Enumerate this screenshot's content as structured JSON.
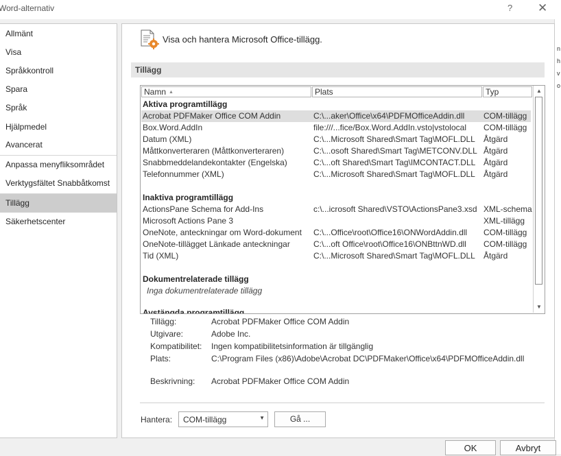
{
  "window": {
    "title": "Word-alternativ",
    "help_glyph": "?",
    "close_glyph": "✕"
  },
  "right_strip": {
    "letters": [
      "n",
      "h",
      "v",
      "o"
    ]
  },
  "nav": {
    "items": [
      {
        "label": "Allmänt"
      },
      {
        "label": "Visa"
      },
      {
        "label": "Språkkontroll"
      },
      {
        "label": "Spara"
      },
      {
        "label": "Språk"
      },
      {
        "label": "Hjälpmedel"
      },
      {
        "label": "Avancerat"
      },
      {
        "label": "Anpassa menyfliksområdet"
      },
      {
        "label": "Verktygsfältet Snabbåtkomst"
      },
      {
        "label": "Tillägg"
      },
      {
        "label": "Säkerhetscenter"
      }
    ]
  },
  "main": {
    "header": "Visa och hantera Microsoft Office-tillägg.",
    "section": "Tillägg",
    "columns": {
      "name": "Namn",
      "location": "Plats",
      "type": "Typ"
    },
    "groups": [
      {
        "title": "Aktiva programtillägg",
        "rows": [
          {
            "name": "Acrobat PDFMaker Office COM Addin",
            "location": "C:\\...aker\\Office\\x64\\PDFMOfficeAddin.dll",
            "type": "COM-tillägg",
            "selected": true
          },
          {
            "name": "Box.Word.AddIn",
            "location": "file:///...fice/Box.Word.AddIn.vsto|vstolocal",
            "type": "COM-tillägg"
          },
          {
            "name": "Datum (XML)",
            "location": "C:\\...Microsoft Shared\\Smart Tag\\MOFL.DLL",
            "type": "Åtgärd"
          },
          {
            "name": "Måttkonverteraren (Måttkonverteraren)",
            "location": "C:\\...osoft Shared\\Smart Tag\\METCONV.DLL",
            "type": "Åtgärd"
          },
          {
            "name": "Snabbmeddelandekontakter (Engelska)",
            "location": "C:\\...oft Shared\\Smart Tag\\IMCONTACT.DLL",
            "type": "Åtgärd"
          },
          {
            "name": "Telefonnummer (XML)",
            "location": "C:\\...Microsoft Shared\\Smart Tag\\MOFL.DLL",
            "type": "Åtgärd"
          }
        ]
      },
      {
        "title": "Inaktiva programtillägg",
        "rows": [
          {
            "name": "ActionsPane Schema for Add-Ins",
            "location": "c:\\...icrosoft Shared\\VSTO\\ActionsPane3.xsd",
            "type": "XML-schema"
          },
          {
            "name": "Microsoft Actions Pane 3",
            "location": "",
            "type": "XML-tillägg"
          },
          {
            "name": "OneNote, anteckningar om Word-dokument",
            "location": "C:\\...Office\\root\\Office16\\ONWordAddin.dll",
            "type": "COM-tillägg"
          },
          {
            "name": "OneNote-tillägget Länkade anteckningar",
            "location": "C:\\...oft Office\\root\\Office16\\ONBttnWD.dll",
            "type": "COM-tillägg"
          },
          {
            "name": "Tid (XML)",
            "location": "C:\\...Microsoft Shared\\Smart Tag\\MOFL.DLL",
            "type": "Åtgärd"
          }
        ]
      },
      {
        "title": "Dokumentrelaterade tillägg",
        "empty_text": "Inga dokumentrelaterade tillägg",
        "rows": []
      },
      {
        "title": "Avstängda programtillägg",
        "rows": []
      }
    ],
    "details": {
      "addin_label": "Tillägg:",
      "addin_value": "Acrobat PDFMaker Office COM Addin",
      "publisher_label": "Utgivare:",
      "publisher_value": "Adobe Inc.",
      "compat_label": "Kompatibilitet:",
      "compat_value": "Ingen kompatibilitetsinformation är tillgänglig",
      "location_label": "Plats:",
      "location_value": "C:\\Program Files (x86)\\Adobe\\Acrobat DC\\PDFMaker\\Office\\x64\\PDFMOfficeAddin.dll",
      "description_label": "Beskrivning:",
      "description_value": "Acrobat PDFMaker Office COM Addin"
    },
    "manage": {
      "label": "Hantera:",
      "selected": "COM-tillägg",
      "go_label": "Gå ..."
    }
  },
  "footer": {
    "ok_label": "OK",
    "cancel_label": "Avbryt"
  },
  "colors": {
    "selected_nav": "#cdcdcd",
    "selected_row": "#dedede",
    "section_bar": "#e6e6e6",
    "gear_accent": "#e8882c"
  }
}
